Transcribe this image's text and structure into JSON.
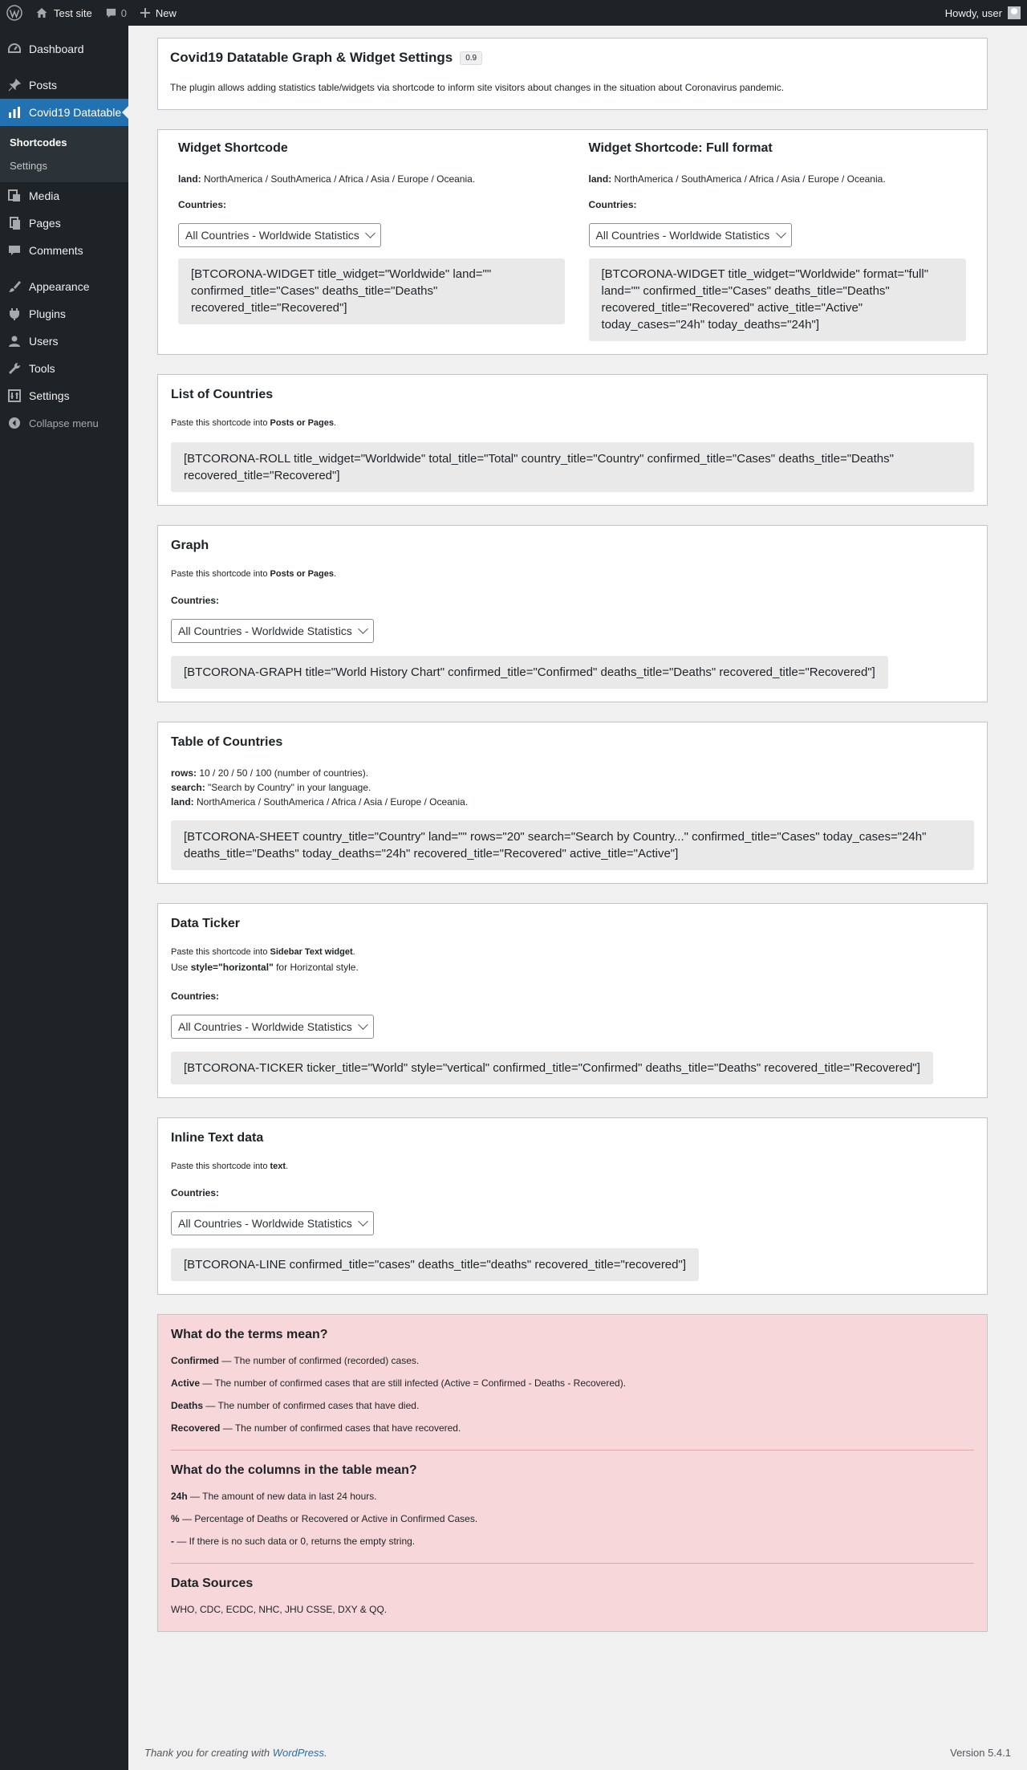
{
  "adminbar": {
    "site": "Test site",
    "comments_count": "0",
    "new_label": "New",
    "howdy": "Howdy, user"
  },
  "sidebar": {
    "items": [
      {
        "label": "Dashboard"
      },
      {
        "label": "Posts"
      },
      {
        "label": "Covid19 Datatable"
      },
      {
        "label": "Media"
      },
      {
        "label": "Pages"
      },
      {
        "label": "Comments"
      },
      {
        "label": "Appearance"
      },
      {
        "label": "Plugins"
      },
      {
        "label": "Users"
      },
      {
        "label": "Tools"
      },
      {
        "label": "Settings"
      }
    ],
    "submenu": [
      "Shortcodes",
      "Settings"
    ],
    "collapse": "Collapse menu"
  },
  "header": {
    "title": "Covid19 Datatable Graph & Widget Settings",
    "version": "0.9",
    "description": "The plugin allows adding statistics table/widgets via shortcode to inform site visitors about changes in the situation about Coronavirus pandemic."
  },
  "common": {
    "land_key": "land:",
    "land_value": " NorthAmerica / SouthAmerica / Africa / Asia / Europe / Oceania.",
    "countries_label": "Countries:",
    "select_value": "All Countries - Worldwide Statistics",
    "paste_prefix": "Paste this shortcode into ",
    "posts_or_pages": "Posts or Pages",
    "period": "."
  },
  "widget": {
    "title": "Widget Shortcode",
    "code": "[BTCORONA-WIDGET title_widget=\"Worldwide\" land=\"\" confirmed_title=\"Cases\" deaths_title=\"Deaths\" recovered_title=\"Recovered\"]"
  },
  "widget_full": {
    "title": "Widget Shortcode: Full format",
    "code": "[BTCORONA-WIDGET title_widget=\"Worldwide\" format=\"full\" land=\"\" confirmed_title=\"Cases\" deaths_title=\"Deaths\" recovered_title=\"Recovered\" active_title=\"Active\" today_cases=\"24h\" today_deaths=\"24h\"]"
  },
  "list": {
    "title": "List of Countries",
    "code": "[BTCORONA-ROLL title_widget=\"Worldwide\" total_title=\"Total\" country_title=\"Country\" confirmed_title=\"Cases\" deaths_title=\"Deaths\" recovered_title=\"Recovered\"]"
  },
  "graph": {
    "title": "Graph",
    "code": "[BTCORONA-GRAPH title=\"World History Chart\" confirmed_title=\"Confirmed\" deaths_title=\"Deaths\" recovered_title=\"Recovered\"]"
  },
  "table": {
    "title": "Table of Countries",
    "rows_key": "rows:",
    "rows_value": " 10 / 20 / 50 / 100 (number of countries).",
    "search_key": "search:",
    "search_value": " \"Search by Country\" in your language.",
    "code": "[BTCORONA-SHEET country_title=\"Country\" land=\"\" rows=\"20\" search=\"Search by Country...\" confirmed_title=\"Cases\" today_cases=\"24h\" deaths_title=\"Deaths\" today_deaths=\"24h\" recovered_title=\"Recovered\" active_title=\"Active\"]"
  },
  "ticker": {
    "title": "Data Ticker",
    "paste_target": "Sidebar Text widget",
    "use_prefix": "Use ",
    "use_style": "style=\"horizontal\"",
    "use_suffix": " for Horizontal style.",
    "code": "[BTCORONA-TICKER ticker_title=\"World\" style=\"vertical\" confirmed_title=\"Confirmed\" deaths_title=\"Deaths\" recovered_title=\"Recovered\"]"
  },
  "inline": {
    "title": "Inline Text data",
    "paste_target": "text",
    "code": "[BTCORONA-LINE confirmed_title=\"cases\" deaths_title=\"deaths\" recovered_title=\"recovered\"]"
  },
  "terms": {
    "title": "What do the terms mean?",
    "items": [
      {
        "term": "Confirmed",
        "desc": " — The number of confirmed (recorded) cases."
      },
      {
        "term": "Active",
        "desc": " — The number of confirmed cases that are still infected (Active = Confirmed - Deaths - Recovered)."
      },
      {
        "term": "Deaths",
        "desc": " — The number of confirmed cases that have died."
      },
      {
        "term": "Recovered",
        "desc": " — The number of confirmed cases that have recovered."
      }
    ],
    "columns_title": "What do the columns in the table mean?",
    "columns": [
      {
        "term": "24h",
        "desc": " — The amount of new data in last 24 hours."
      },
      {
        "term": "%",
        "desc": " — Percentage of Deaths or Recovered or Active in Confirmed Cases."
      },
      {
        "term": "-",
        "desc": " — If there is no such data or 0, returns the empty string."
      }
    ],
    "sources_title": "Data Sources",
    "sources": "WHO, CDC, ECDC, NHC, JHU CSSE, DXY & QQ."
  },
  "footer": {
    "thanks": "Thank you for creating with ",
    "link": "WordPress",
    "version": "Version 5.4.1"
  }
}
